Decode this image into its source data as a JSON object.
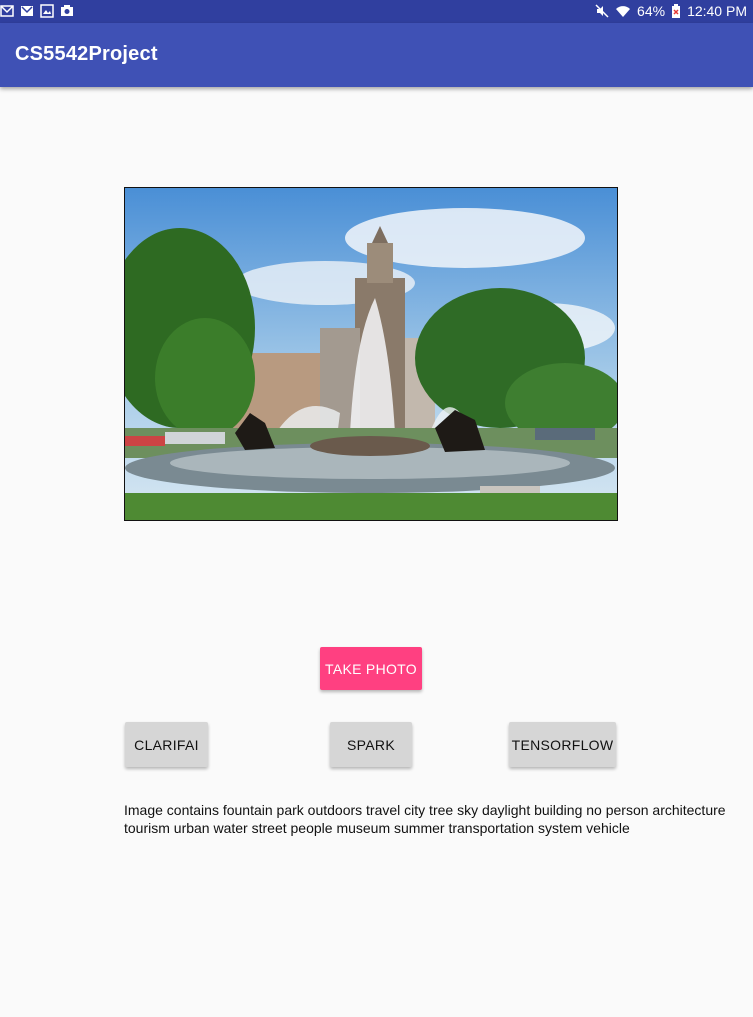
{
  "status_bar": {
    "battery_text": "64%",
    "time": "12:40 PM",
    "left_icons": [
      "email-icon",
      "gmail-icon",
      "image-icon",
      "camera-icon"
    ],
    "right_icons": [
      "mute-icon",
      "wifi-icon",
      "battery-icon"
    ]
  },
  "app_bar": {
    "title": "CS5542Project",
    "color": "#3f51b5"
  },
  "photo": {
    "description_icon": "fountain-photo"
  },
  "buttons": {
    "take_photo": "TAKE PHOTO",
    "clarifai": "CLARIFAI",
    "spark": "SPARK",
    "tensorflow": "TENSORFLOW"
  },
  "result_text": "Image contains fountain park outdoors travel city tree sky daylight building no person architecture tourism urban water street people museum summer transportation system vehicle",
  "colors": {
    "status_bar": "#303f9f",
    "accent": "#ff4081",
    "gray_button": "#d6d6d6"
  }
}
